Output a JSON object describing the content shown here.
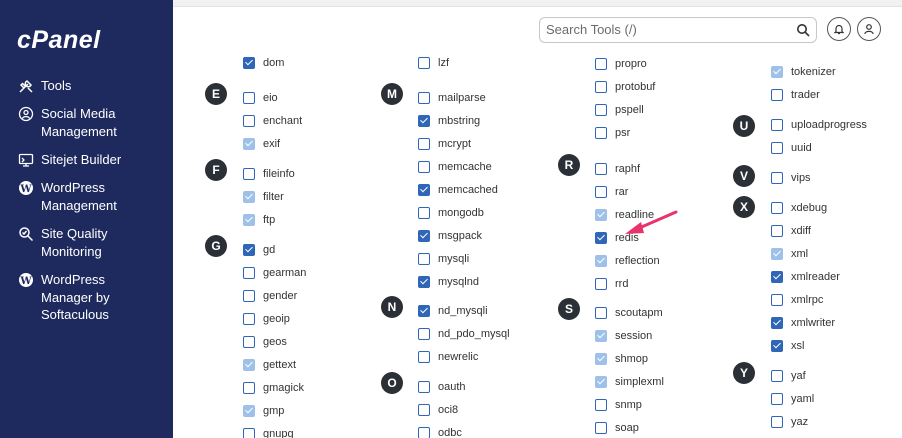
{
  "brand": {
    "logo": "cPanel"
  },
  "sidebar": {
    "items": [
      {
        "label": "Tools",
        "icon": "tools-icon"
      },
      {
        "label": "Social Media\nManagement",
        "icon": "social-icon"
      },
      {
        "label": "Sitejet Builder",
        "icon": "sitejet-icon"
      },
      {
        "label": "WordPress\nManagement",
        "icon": "wordpress-icon"
      },
      {
        "label": "Site Quality\nMonitoring",
        "icon": "site-quality-icon"
      },
      {
        "label": "WordPress\nManager by\nSoftaculous",
        "icon": "wordpress-icon"
      }
    ]
  },
  "header": {
    "search_placeholder": "Search Tools (/)"
  },
  "sections": [
    {
      "letter": "E"
    },
    {
      "letter": "F"
    },
    {
      "letter": "G"
    },
    {
      "letter": "M"
    },
    {
      "letter": "N"
    },
    {
      "letter": "O"
    },
    {
      "letter": "R"
    },
    {
      "letter": "S"
    },
    {
      "letter": "U"
    },
    {
      "letter": "V"
    },
    {
      "letter": "X"
    },
    {
      "letter": "Y"
    }
  ],
  "columns": [
    {
      "items": [
        {
          "name": "dom",
          "checked": true,
          "disabled": false
        },
        {
          "name": "eio",
          "checked": false,
          "disabled": false
        },
        {
          "name": "enchant",
          "checked": false,
          "disabled": false
        },
        {
          "name": "exif",
          "checked": true,
          "disabled": true
        },
        {
          "name": "fileinfo",
          "checked": false,
          "disabled": false
        },
        {
          "name": "filter",
          "checked": true,
          "disabled": true
        },
        {
          "name": "ftp",
          "checked": true,
          "disabled": true
        },
        {
          "name": "gd",
          "checked": true,
          "disabled": false
        },
        {
          "name": "gearman",
          "checked": false,
          "disabled": false
        },
        {
          "name": "gender",
          "checked": false,
          "disabled": false
        },
        {
          "name": "geoip",
          "checked": false,
          "disabled": false
        },
        {
          "name": "geos",
          "checked": false,
          "disabled": false
        },
        {
          "name": "gettext",
          "checked": true,
          "disabled": true
        },
        {
          "name": "gmagick",
          "checked": false,
          "disabled": false
        },
        {
          "name": "gmp",
          "checked": true,
          "disabled": true
        },
        {
          "name": "gnupg",
          "checked": false,
          "disabled": false
        }
      ]
    },
    {
      "items": [
        {
          "name": "lzf",
          "checked": false,
          "disabled": false
        },
        {
          "name": "mailparse",
          "checked": false,
          "disabled": false
        },
        {
          "name": "mbstring",
          "checked": true,
          "disabled": false
        },
        {
          "name": "mcrypt",
          "checked": false,
          "disabled": false
        },
        {
          "name": "memcache",
          "checked": false,
          "disabled": false
        },
        {
          "name": "memcached",
          "checked": true,
          "disabled": false
        },
        {
          "name": "mongodb",
          "checked": false,
          "disabled": false
        },
        {
          "name": "msgpack",
          "checked": true,
          "disabled": false
        },
        {
          "name": "mysqli",
          "checked": false,
          "disabled": false
        },
        {
          "name": "mysqlnd",
          "checked": true,
          "disabled": false
        },
        {
          "name": "nd_mysqli",
          "checked": true,
          "disabled": false
        },
        {
          "name": "nd_pdo_mysql",
          "checked": false,
          "disabled": false
        },
        {
          "name": "newrelic",
          "checked": false,
          "disabled": false
        },
        {
          "name": "oauth",
          "checked": false,
          "disabled": false
        },
        {
          "name": "oci8",
          "checked": false,
          "disabled": false
        },
        {
          "name": "odbc",
          "checked": false,
          "disabled": false
        }
      ]
    },
    {
      "items": [
        {
          "name": "propro",
          "checked": false,
          "disabled": false
        },
        {
          "name": "protobuf",
          "checked": false,
          "disabled": false
        },
        {
          "name": "pspell",
          "checked": false,
          "disabled": false
        },
        {
          "name": "psr",
          "checked": false,
          "disabled": false
        },
        {
          "name": "raphf",
          "checked": false,
          "disabled": false
        },
        {
          "name": "rar",
          "checked": false,
          "disabled": false
        },
        {
          "name": "readline",
          "checked": true,
          "disabled": true
        },
        {
          "name": "redis",
          "checked": true,
          "disabled": false
        },
        {
          "name": "reflection",
          "checked": true,
          "disabled": true
        },
        {
          "name": "rrd",
          "checked": false,
          "disabled": false
        },
        {
          "name": "scoutapm",
          "checked": false,
          "disabled": false
        },
        {
          "name": "session",
          "checked": true,
          "disabled": true
        },
        {
          "name": "shmop",
          "checked": true,
          "disabled": true
        },
        {
          "name": "simplexml",
          "checked": true,
          "disabled": true
        },
        {
          "name": "snmp",
          "checked": false,
          "disabled": false
        },
        {
          "name": "soap",
          "checked": false,
          "disabled": false
        }
      ]
    },
    {
      "items": [
        {
          "name": "tokenizer",
          "checked": true,
          "disabled": true
        },
        {
          "name": "trader",
          "checked": false,
          "disabled": false
        },
        {
          "name": "uploadprogress",
          "checked": false,
          "disabled": false
        },
        {
          "name": "uuid",
          "checked": false,
          "disabled": false
        },
        {
          "name": "vips",
          "checked": false,
          "disabled": false
        },
        {
          "name": "xdebug",
          "checked": false,
          "disabled": false
        },
        {
          "name": "xdiff",
          "checked": false,
          "disabled": false
        },
        {
          "name": "xml",
          "checked": true,
          "disabled": true
        },
        {
          "name": "xmlreader",
          "checked": true,
          "disabled": false
        },
        {
          "name": "xmlrpc",
          "checked": false,
          "disabled": false
        },
        {
          "name": "xmlwriter",
          "checked": true,
          "disabled": false
        },
        {
          "name": "xsl",
          "checked": true,
          "disabled": false
        },
        {
          "name": "yaf",
          "checked": false,
          "disabled": false
        },
        {
          "name": "yaml",
          "checked": false,
          "disabled": false
        },
        {
          "name": "yaz",
          "checked": false,
          "disabled": false
        }
      ]
    }
  ],
  "colors": {
    "sidebar": "#1e2a5e",
    "checkbox": "#2f66b8",
    "checkbox_disabled": "#9fc0e8",
    "badge": "#2b3036",
    "annotation_arrow": "#e8336b"
  }
}
